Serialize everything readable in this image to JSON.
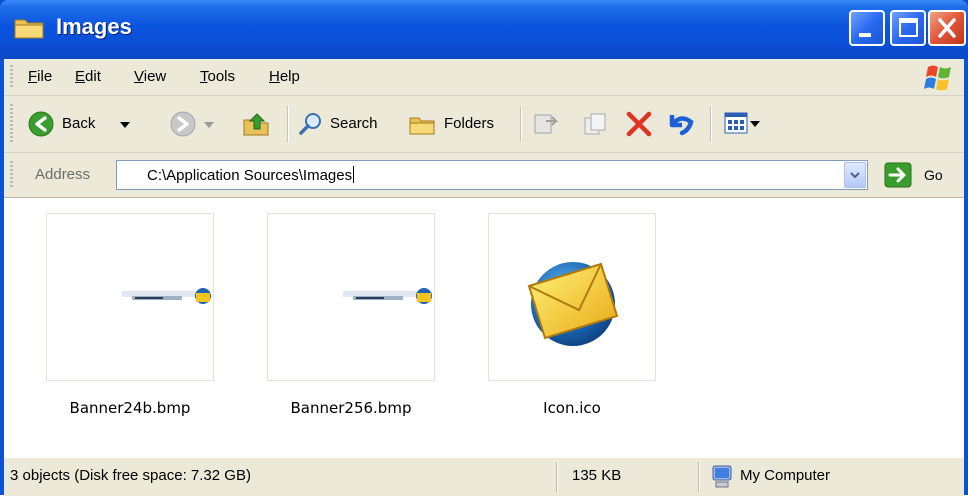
{
  "window": {
    "title": "Images"
  },
  "menu": {
    "file": "ile",
    "file_key": "F",
    "edit": "dit",
    "edit_key": "E",
    "view": "iew",
    "view_key": "V",
    "tools": "ools",
    "tools_key": "T",
    "help": "elp",
    "help_key": "H"
  },
  "toolbar": {
    "back_label": "Back",
    "search_label": "Search",
    "folders_label": "Folders"
  },
  "address": {
    "label": "Address",
    "value": "C:\\Application Sources\\Images",
    "go_label": "Go"
  },
  "files": [
    {
      "name": "Banner24b.bmp"
    },
    {
      "name": "Banner256.bmp"
    },
    {
      "name": "Icon.ico"
    }
  ],
  "status": {
    "objects": "3 objects (Disk free space: 7.32 GB)",
    "size": "135 KB",
    "zone": "My Computer"
  },
  "colors": {
    "titlebar": "#0a4fd6",
    "chrome": "#ece9d8",
    "close": "#e0553a"
  }
}
